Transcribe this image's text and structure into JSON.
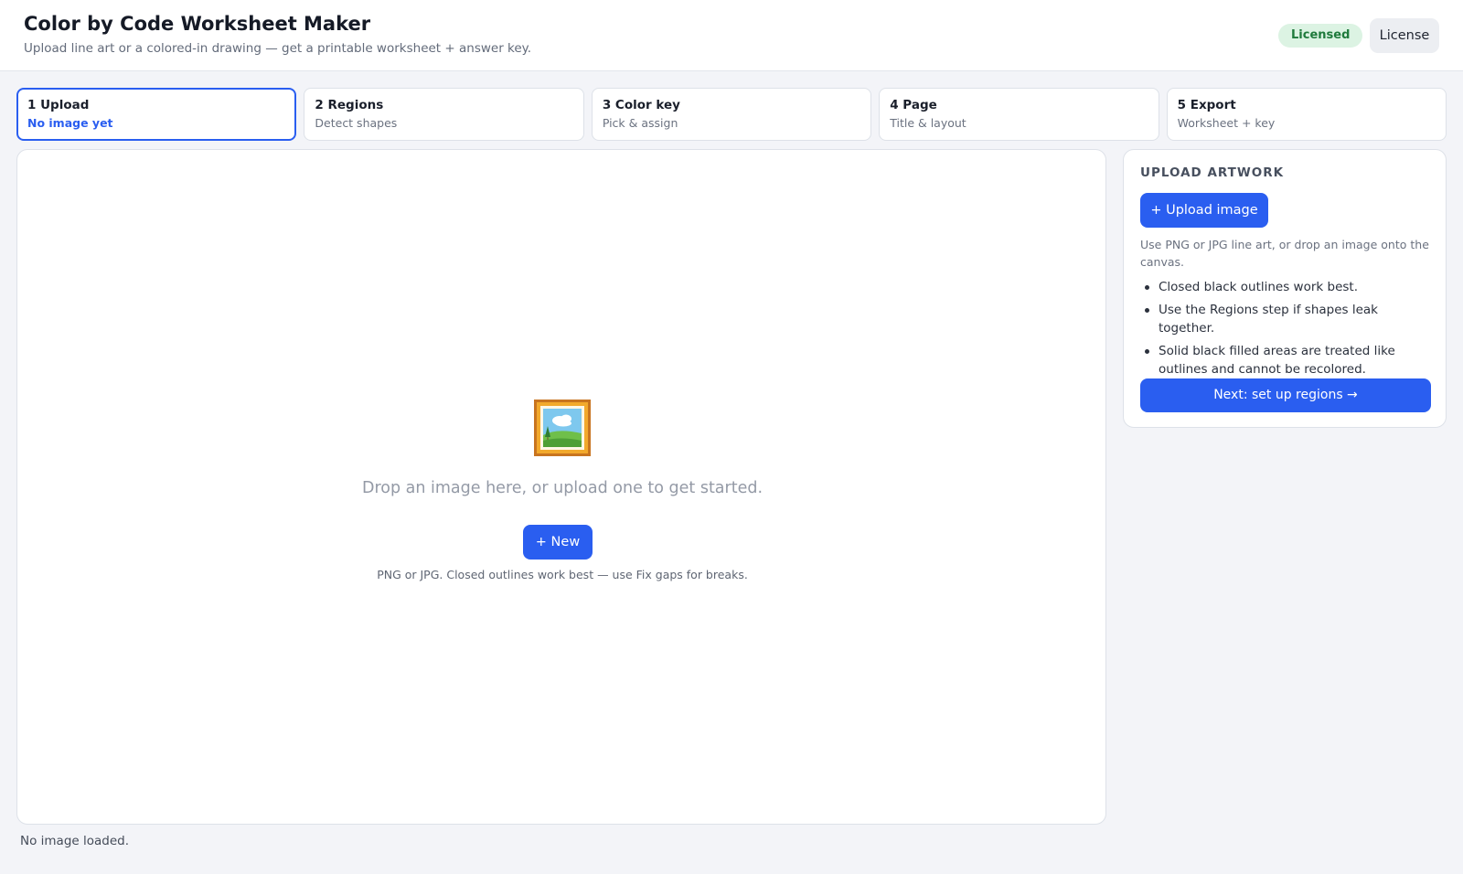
{
  "header": {
    "title": "Color by Code Worksheet Maker",
    "subtitle": "Upload line art or a colored-in drawing — get a printable worksheet + answer key.",
    "license_badge": "Licensed",
    "license_button": "License"
  },
  "steps": [
    {
      "title": "1 Upload",
      "subtitle": "No image yet",
      "active": true
    },
    {
      "title": "2 Regions",
      "subtitle": "Detect shapes",
      "active": false
    },
    {
      "title": "3 Color key",
      "subtitle": "Pick & assign",
      "active": false
    },
    {
      "title": "4 Page",
      "subtitle": "Title & layout",
      "active": false
    },
    {
      "title": "5 Export",
      "subtitle": "Worksheet + key",
      "active": false
    }
  ],
  "canvas": {
    "empty_icon": "framed-picture-icon",
    "empty_text": "Drop an image here, or upload one to get started.",
    "new_button": "+ New",
    "hint": "PNG or JPG. Closed outlines work best — use Fix gaps for breaks."
  },
  "status": "No image loaded.",
  "panel": {
    "heading": "UPLOAD ARTWORK",
    "upload_button": "+ Upload image",
    "help": "Use PNG or JPG line art, or drop an image onto the canvas.",
    "tips": [
      "Closed black outlines work best.",
      "Use the Regions step if shapes leak together.",
      "Solid black filled areas are treated like outlines and cannot be recolored."
    ],
    "next_button": "Next: set up regions →"
  },
  "colors": {
    "accent": "#2a5ef0",
    "licensed_bg": "#dcf3e3",
    "licensed_text": "#1f7a3c",
    "page_bg": "#f3f4f8"
  }
}
